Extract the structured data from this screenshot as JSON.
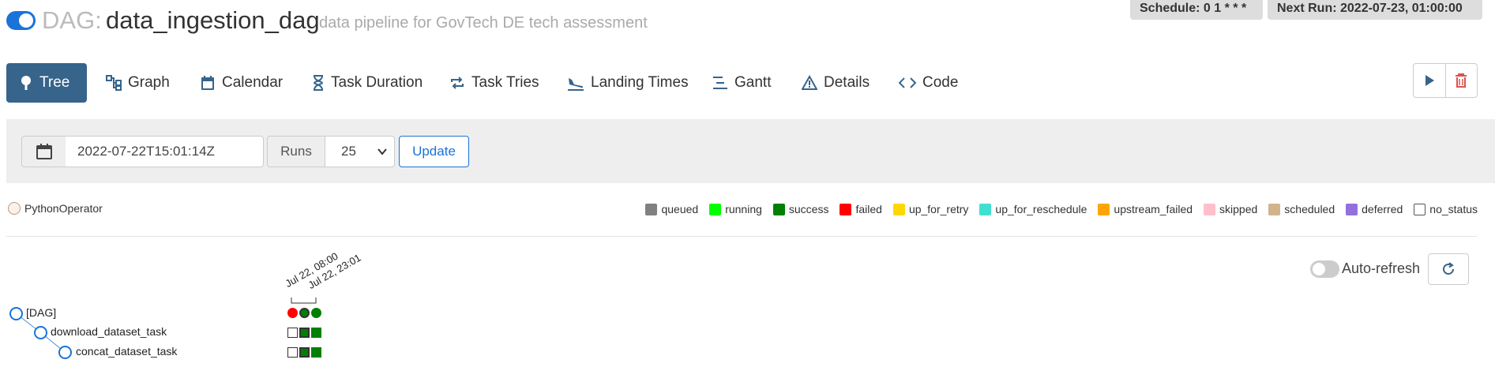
{
  "header": {
    "dag_prefix": "DAG:",
    "dag_id": "data_ingestion_dag",
    "description": "data pipeline for GovTech DE tech assessment",
    "schedule": "Schedule: 0 1 * * *",
    "next_run": "Next Run: 2022-07-23, 01:00:00",
    "dag_active": true
  },
  "tabs": [
    {
      "label": "Tree",
      "icon": "tree-icon",
      "active": true
    },
    {
      "label": "Graph",
      "icon": "graph-icon"
    },
    {
      "label": "Calendar",
      "icon": "calendar-icon"
    },
    {
      "label": "Task Duration",
      "icon": "hourglass-icon"
    },
    {
      "label": "Task Tries",
      "icon": "repeat-icon"
    },
    {
      "label": "Landing Times",
      "icon": "plane-landing-icon"
    },
    {
      "label": "Gantt",
      "icon": "gantt-icon"
    },
    {
      "label": "Details",
      "icon": "warning-triangle-icon"
    },
    {
      "label": "Code",
      "icon": "code-icon"
    }
  ],
  "actions": {
    "trigger": "play-icon",
    "delete": "trash-icon"
  },
  "filters": {
    "base_date": "2022-07-22T15:01:14Z",
    "runs_label": "Runs",
    "num_runs": "25",
    "update_label": "Update"
  },
  "operator_legend": {
    "label": "PythonOperator"
  },
  "state_legend": [
    {
      "label": "queued",
      "color": "#808080"
    },
    {
      "label": "running",
      "color": "#00ff00"
    },
    {
      "label": "success",
      "color": "#008000"
    },
    {
      "label": "failed",
      "color": "#ff0000"
    },
    {
      "label": "up_for_retry",
      "color": "#ffd700"
    },
    {
      "label": "up_for_reschedule",
      "color": "#40e0d0"
    },
    {
      "label": "upstream_failed",
      "color": "#ffa500"
    },
    {
      "label": "skipped",
      "color": "#ffc0cb"
    },
    {
      "label": "scheduled",
      "color": "#d2b48c"
    },
    {
      "label": "deferred",
      "color": "#9370db"
    },
    {
      "label": "no_status",
      "color": "#ffffff"
    }
  ],
  "auto_refresh": {
    "label": "Auto-refresh",
    "enabled": false
  },
  "tree": {
    "run_dates": [
      "Jul 22, 08:00",
      "Jul 22, 23:01"
    ],
    "dag_runs": [
      "failed",
      "success",
      "success"
    ],
    "nodes": [
      {
        "label": "[DAG]",
        "depth": 0
      },
      {
        "label": "download_dataset_task",
        "depth": 1,
        "instances": [
          "no_status",
          "success",
          "success"
        ]
      },
      {
        "label": "concat_dataset_task",
        "depth": 2,
        "instances": [
          "no_status",
          "success",
          "success"
        ]
      }
    ]
  }
}
